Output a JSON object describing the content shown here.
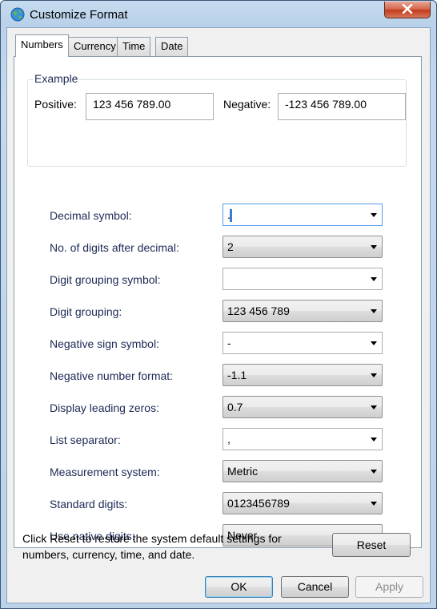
{
  "window": {
    "title": "Customize Format"
  },
  "tabs": [
    {
      "label": "Numbers"
    },
    {
      "label": "Currency"
    },
    {
      "label": "Time"
    },
    {
      "label": "Date"
    }
  ],
  "example": {
    "legend": "Example",
    "positive_label": "Positive:",
    "positive_value": "123 456 789.00",
    "negative_label": "Negative:",
    "negative_value": "-123 456 789.00"
  },
  "settings": [
    {
      "label": "Decimal symbol:",
      "value": ".",
      "editable": true,
      "focused": true
    },
    {
      "label": "No. of digits after decimal:",
      "value": "2",
      "editable": false
    },
    {
      "label": "Digit grouping symbol:",
      "value": " ",
      "editable": true
    },
    {
      "label": "Digit grouping:",
      "value": "123 456 789",
      "editable": false
    },
    {
      "label": "Negative sign symbol:",
      "value": "-",
      "editable": true
    },
    {
      "label": "Negative number format:",
      "value": "-1.1",
      "editable": false
    },
    {
      "label": "Display leading zeros:",
      "value": "0.7",
      "editable": false
    },
    {
      "label": "List separator:",
      "value": ",",
      "editable": true
    },
    {
      "label": "Measurement system:",
      "value": "Metric",
      "editable": false
    },
    {
      "label": "Standard digits:",
      "value": "0123456789",
      "editable": false
    },
    {
      "label": "Use native digits:",
      "value": "Never",
      "editable": false
    }
  ],
  "reset": {
    "note": "Click Reset to restore the system default settings for numbers, currency, time, and date.",
    "button_label": "Reset"
  },
  "footer": {
    "ok_label": "OK",
    "cancel_label": "Cancel",
    "apply_label": "Apply"
  },
  "icons": {
    "title": "globe-icon",
    "close": "close-icon"
  },
  "colors": {
    "label_text": "#1b2a55",
    "focus_border": "#569de5"
  }
}
